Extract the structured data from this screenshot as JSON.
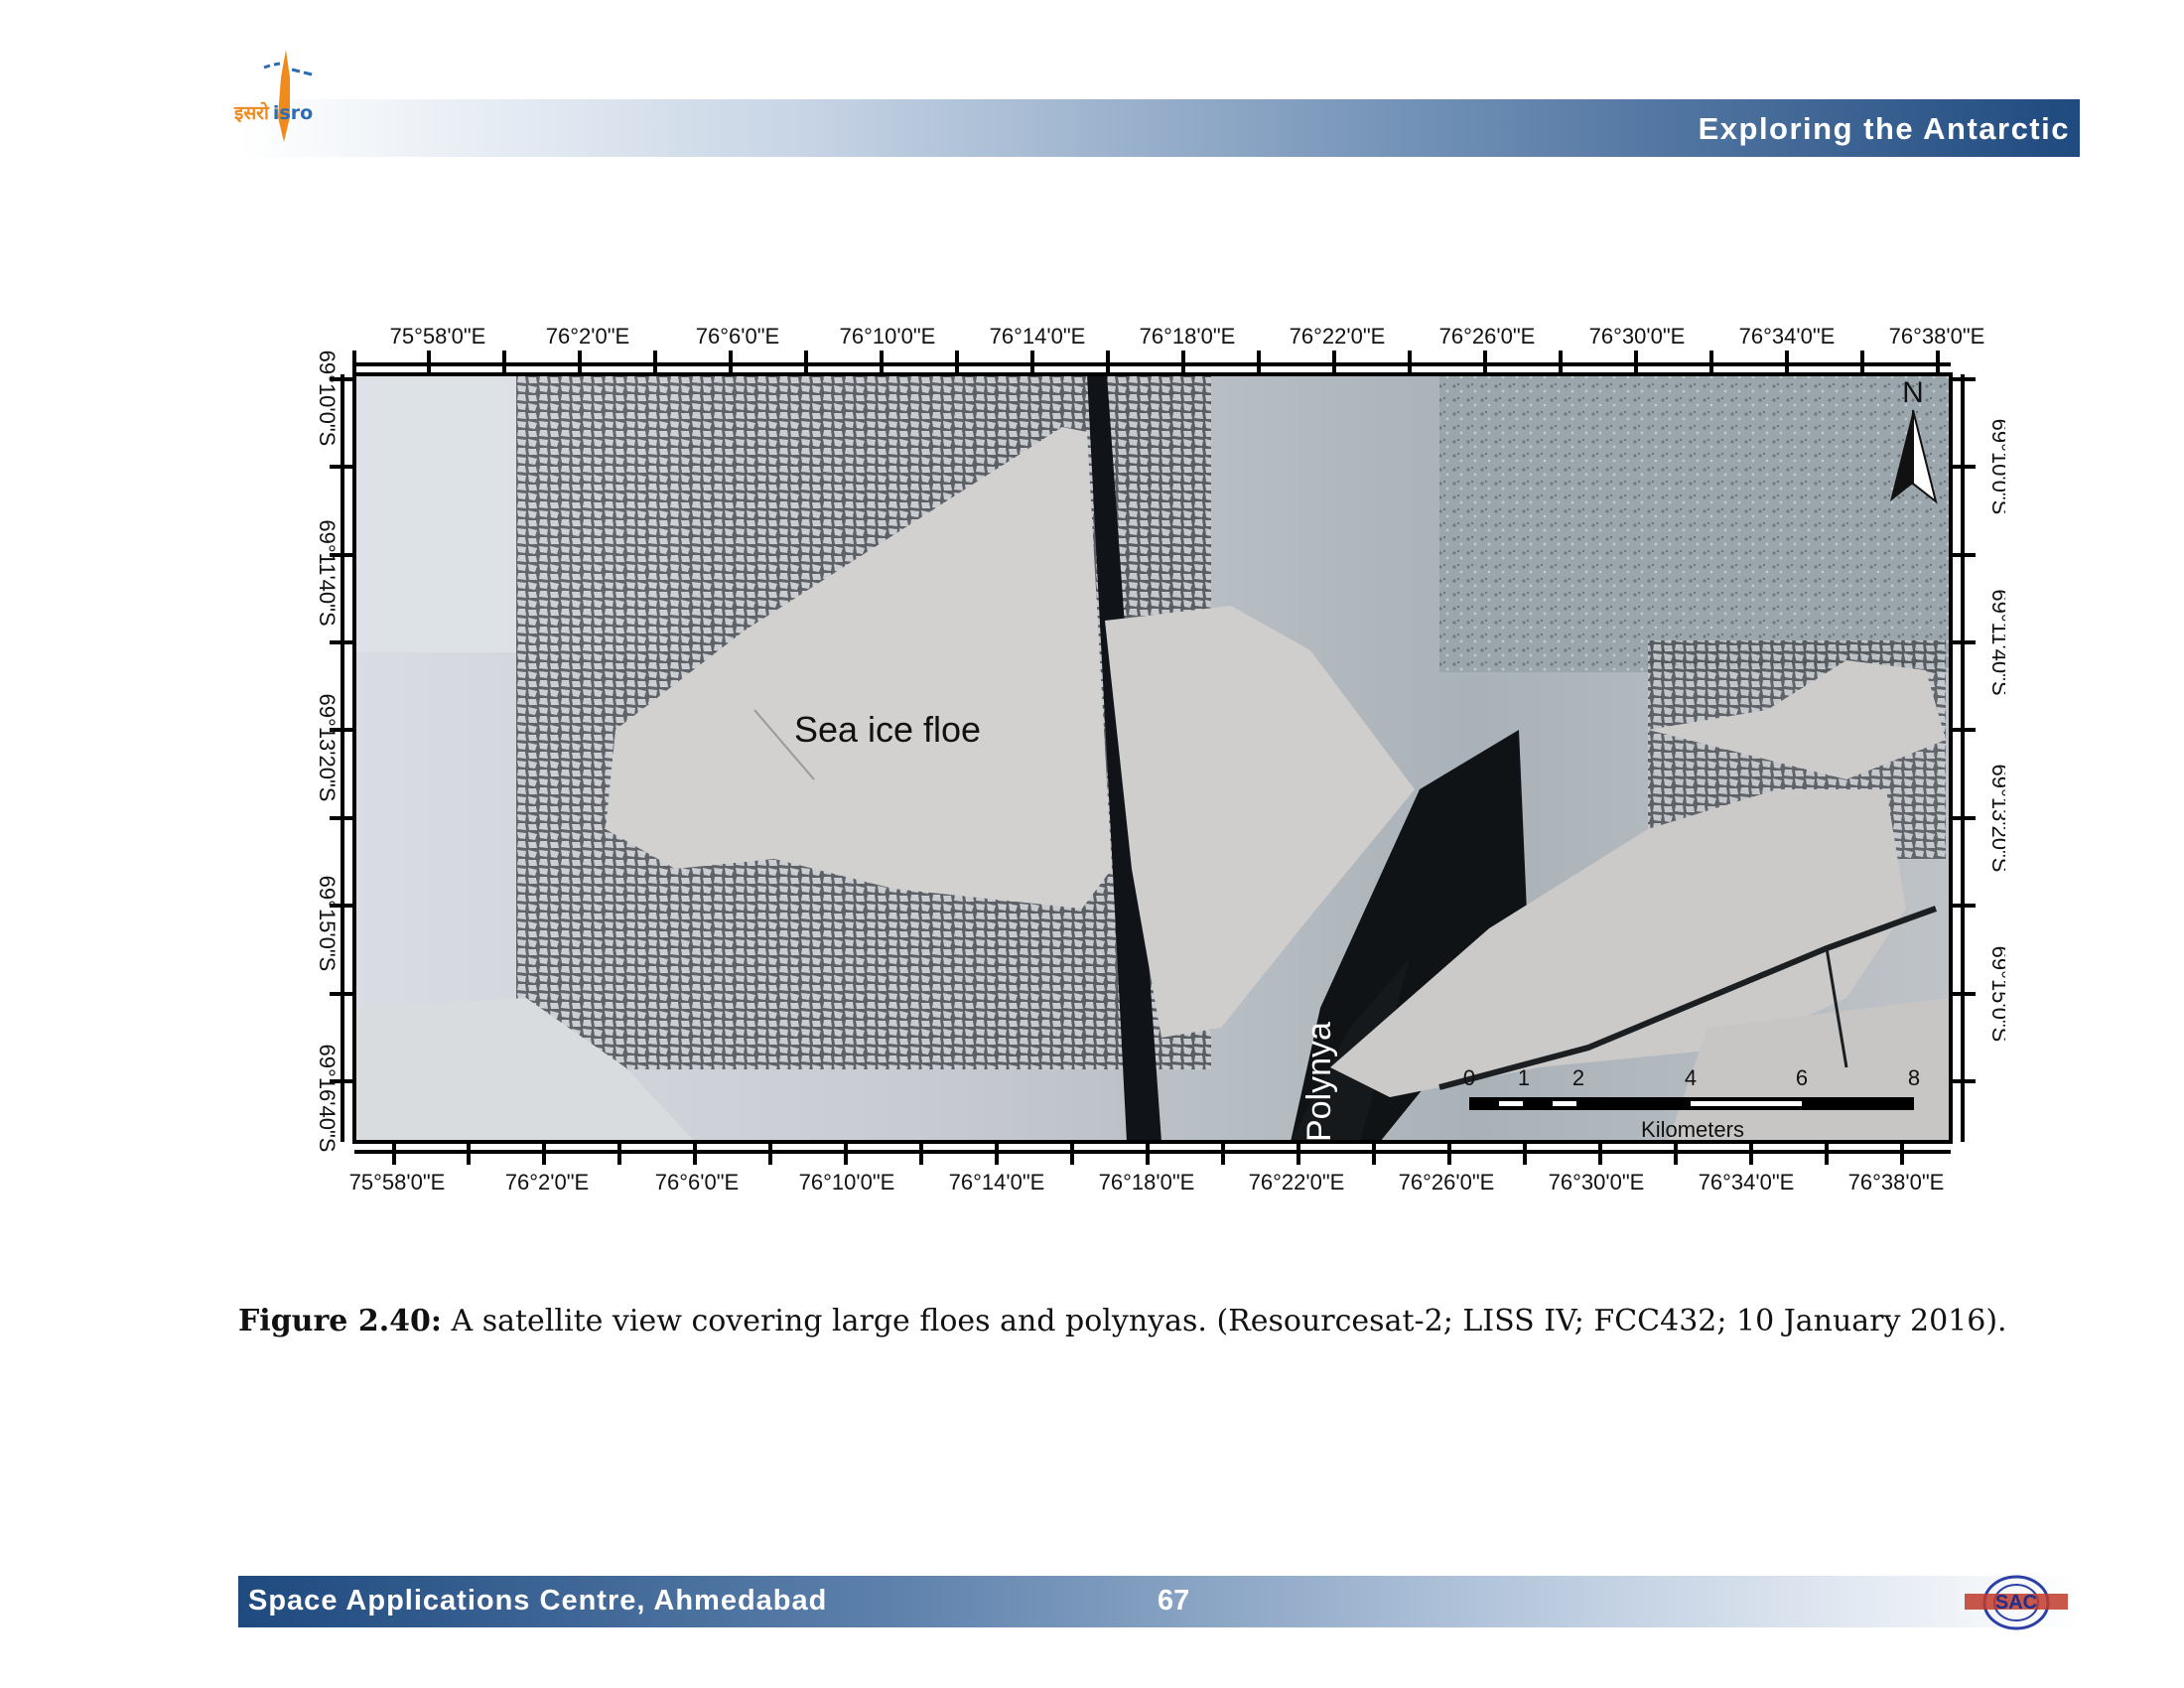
{
  "header": {
    "title": "Exploring the Antarctic",
    "logo_hindi": "इसरो",
    "logo_latin": "isro"
  },
  "figure": {
    "top_lon_labels": [
      "75°58'0\"E",
      "76°2'0\"E",
      "76°6'0\"E",
      "76°10'0\"E",
      "76°14'0\"E",
      "76°18'0\"E",
      "76°22'0\"E",
      "76°26'0\"E",
      "76°30'0\"E",
      "76°34'0\"E",
      "76°38'0\"E"
    ],
    "bottom_lon_labels": [
      "75°58'0\"E",
      "76°2'0\"E",
      "76°6'0\"E",
      "76°10'0\"E",
      "76°14'0\"E",
      "76°18'0\"E",
      "76°22'0\"E",
      "76°26'0\"E",
      "76°30'0\"E",
      "76°34'0\"E",
      "76°38'0\"E"
    ],
    "left_lat_labels": [
      "69°10'0\"S",
      "69°11'40\"S",
      "69°13'20\"S",
      "69°15'0\"S",
      "69°16'40\"S"
    ],
    "right_lat_labels": [
      "69°10'0\"S",
      "69°11'40\"S",
      "69°13'20\"S",
      "69°15'0\"S"
    ],
    "floe_label": "Sea ice floe",
    "polynya_label": "Polynya",
    "north_label": "N",
    "scale_ticks": [
      "0",
      "1",
      "2",
      "4",
      "6",
      "8"
    ],
    "scale_unit": "Kilometers"
  },
  "caption": {
    "label": "Figure 2.40:",
    "text": " A satellite view covering large floes and polynyas. (Resourcesat-2; LISS IV; FCC432; 10 January 2016)."
  },
  "footer": {
    "org": "Space Applications Centre, Ahmedabad",
    "page": "67",
    "logo_text": "SAC"
  }
}
